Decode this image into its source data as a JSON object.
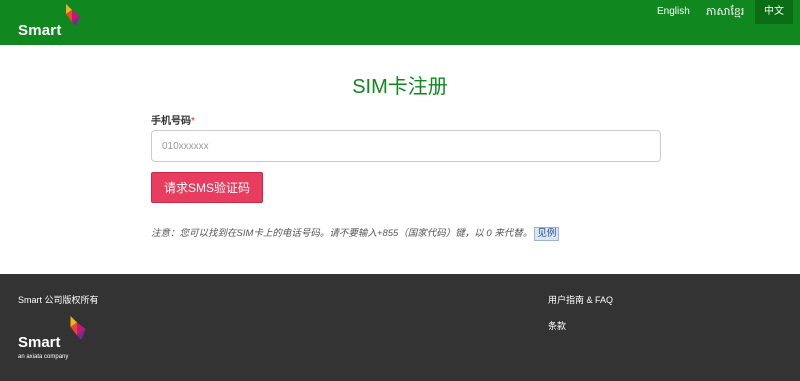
{
  "header": {
    "brand": "Smart",
    "languages": [
      "English",
      "ភាសាខ្មែរ",
      "中文"
    ],
    "active_language": "中文"
  },
  "form": {
    "title": "SIM卡注册",
    "phone_label": "手机号码",
    "required_mark": "*",
    "phone_placeholder": "010xxxxxx",
    "submit_label": "请求SMS验证码",
    "note": "注意：您可以找到在SIM卡上的电话号码。请不要输入+855（国家代码）键，以 0 来代替。",
    "note_link": "见例"
  },
  "footer": {
    "copyright": "Smart 公司版权所有",
    "brand": "Smart",
    "tagline": "an axiata company",
    "links": [
      "用户指南 & FAQ",
      "条款"
    ]
  },
  "colors": {
    "brand_green": "#10871f",
    "button_red": "#e83d5f",
    "footer_bg": "#333333"
  },
  "icons": {
    "logo_mark": "smart-logo-icon"
  }
}
